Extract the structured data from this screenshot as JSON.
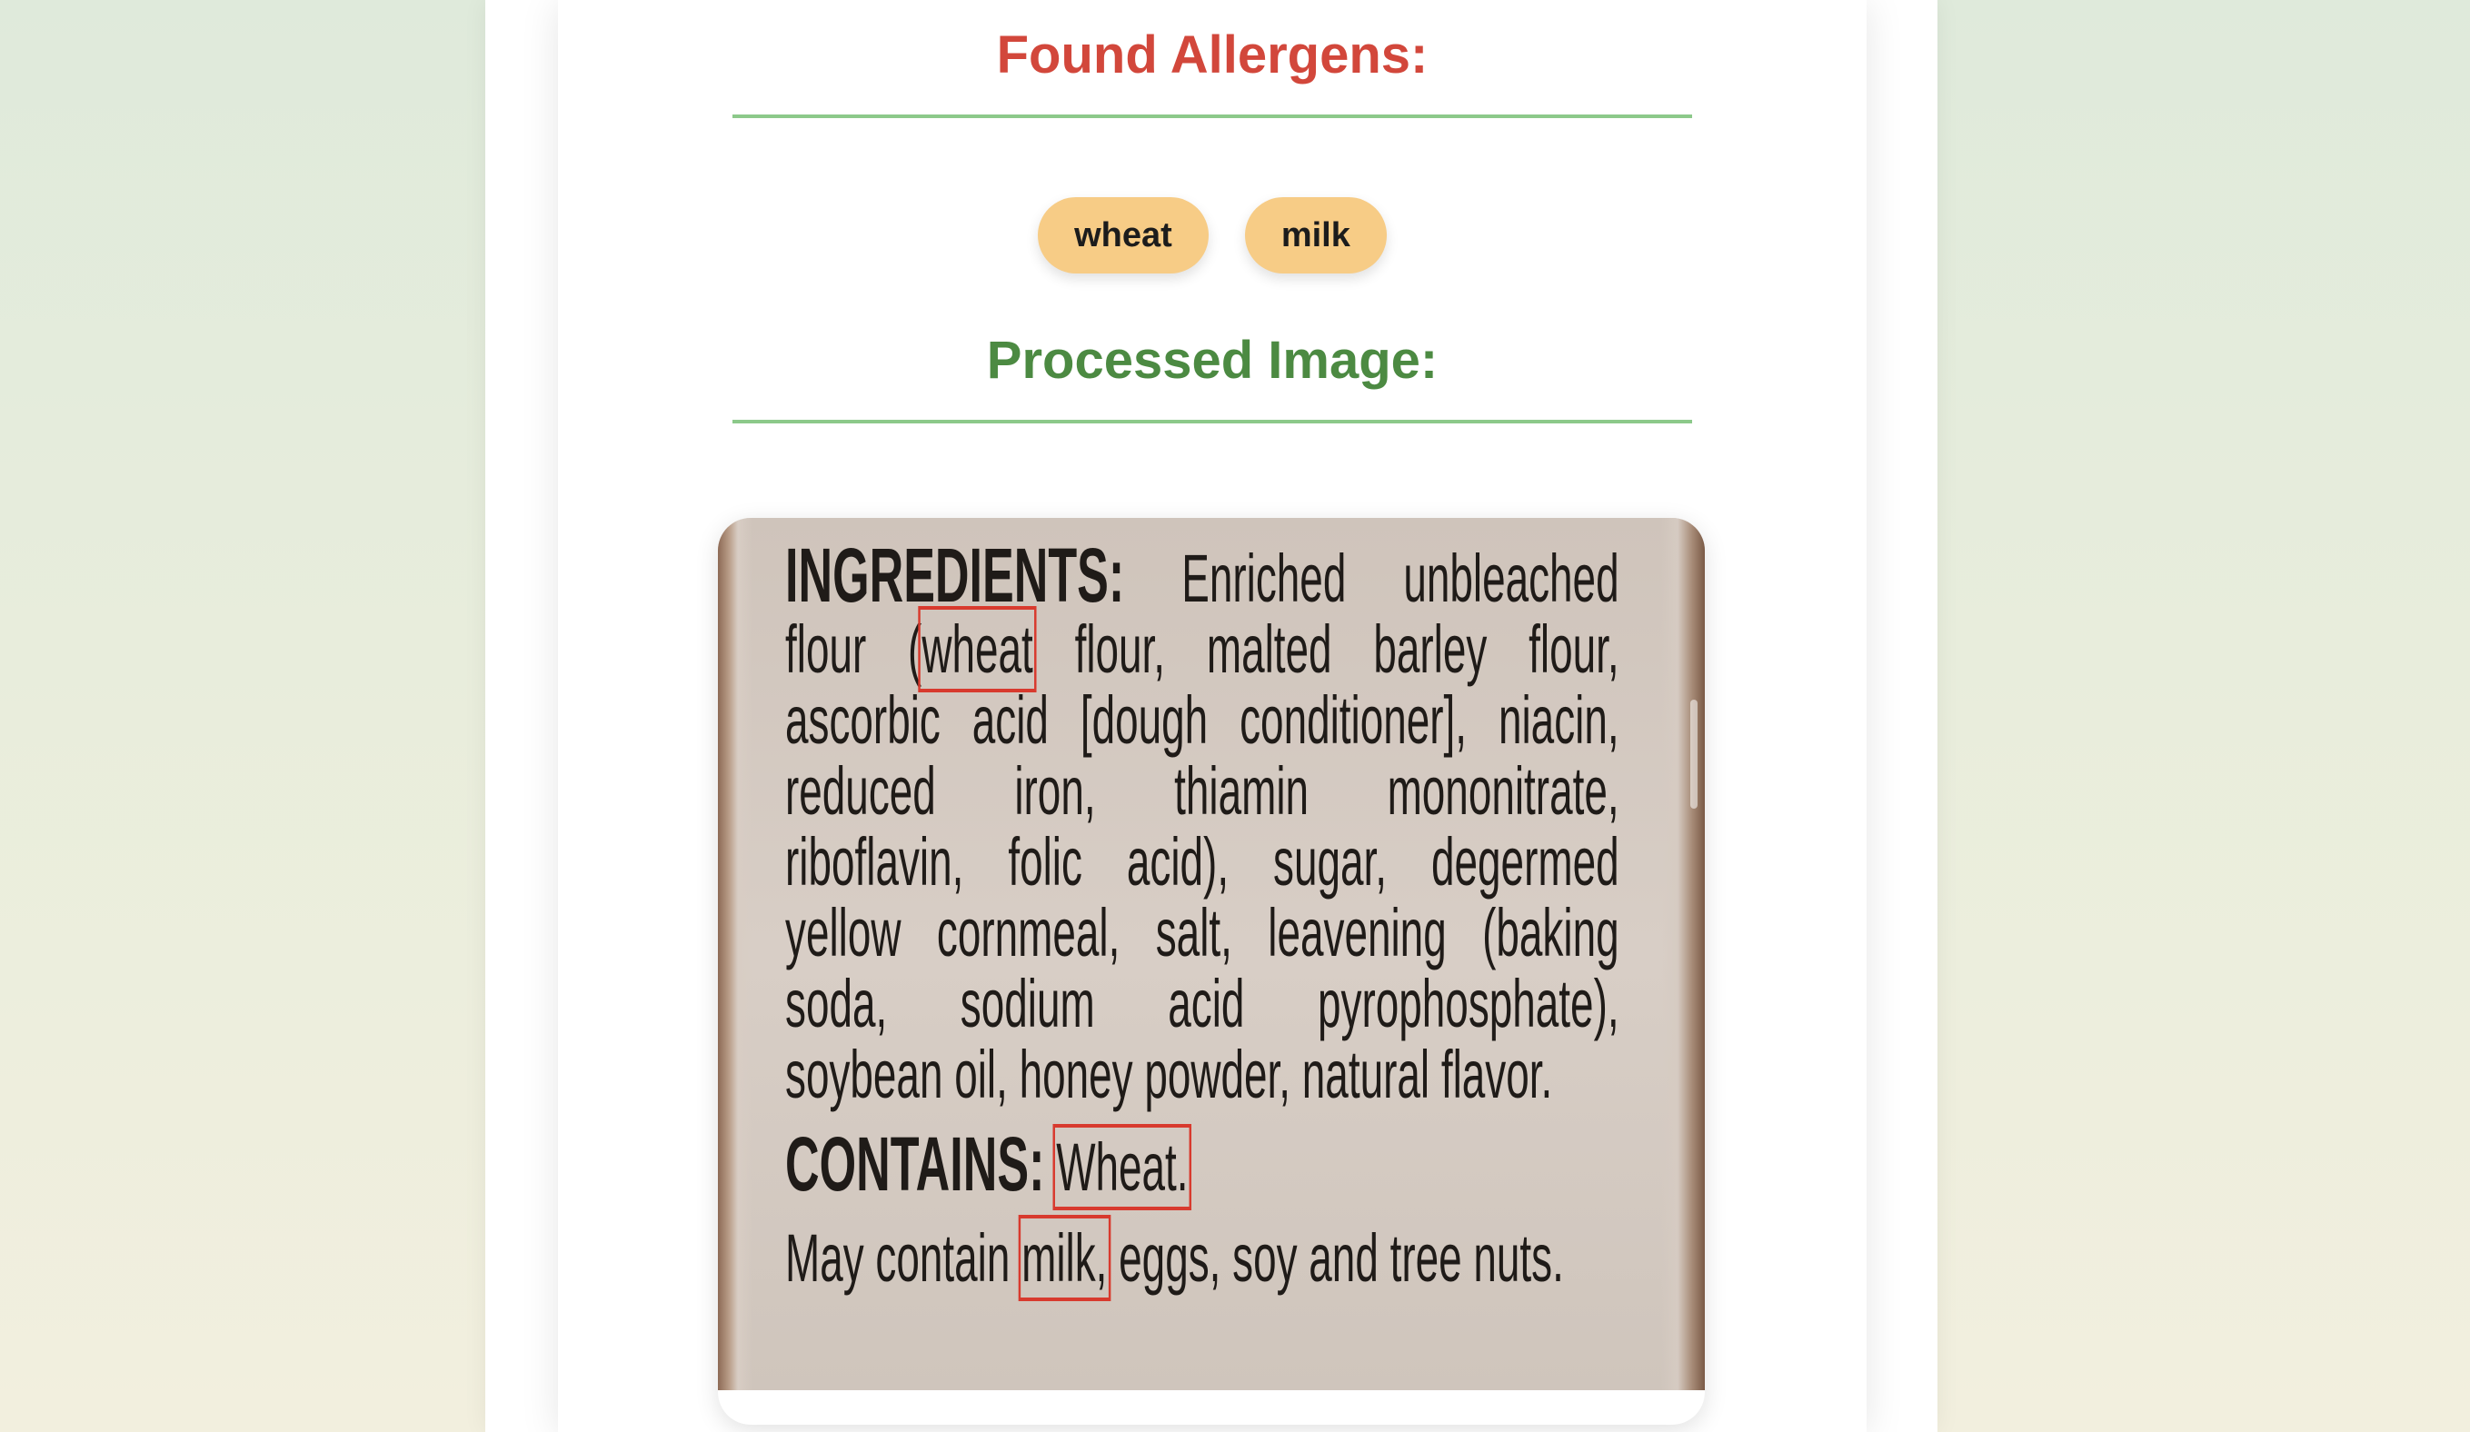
{
  "results": {
    "found_heading": "Found Allergens:",
    "allergens": [
      "wheat",
      "milk"
    ],
    "processed_heading": "Processed Image:"
  },
  "label": {
    "line1_bold": "INGREDIENTS:",
    "line1_rest": "Enriched unbleached",
    "line2_pre": "flour (",
    "line2_hl": "wheat",
    "line2_post": " flour, malted barley flour,",
    "line3": "ascorbic acid [dough conditioner], niacin,",
    "line4": "reduced iron, thiamin mononitrate,",
    "line5": "riboflavin, folic acid), sugar, degermed",
    "line6": "yellow cornmeal, salt, leavening (baking",
    "line7": "soda, sodium acid pyrophosphate),",
    "line8": "soybean oil, honey powder, natural flavor.",
    "contains_bold": "CONTAINS:",
    "contains_hl": "Wheat.",
    "may_pre": "May contain ",
    "may_hl": "milk,",
    "may_post": " eggs, soy and tree nuts."
  },
  "colors": {
    "found_heading": "#d2473b",
    "processed_heading": "#4c8a42",
    "divider": "#8cc98a",
    "tag_background": "#f7cc86",
    "highlight_box": "#d83a2e"
  }
}
